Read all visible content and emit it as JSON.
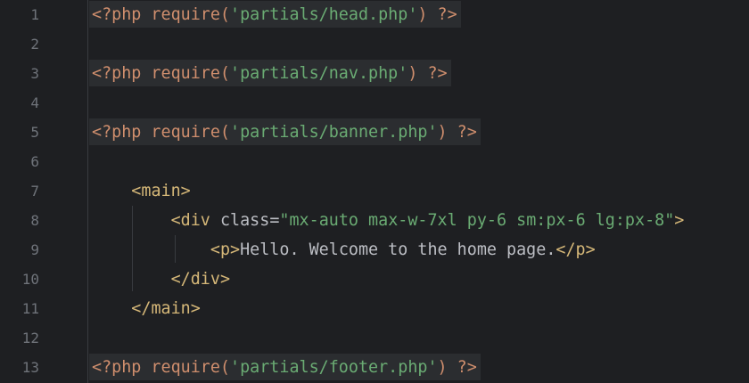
{
  "editor": {
    "lines": [
      {
        "n": "1",
        "parts": [
          [
            "php",
            "<?php require("
          ],
          [
            "str",
            "'partials/head.php'"
          ],
          [
            "php",
            ") ?>"
          ]
        ]
      },
      {
        "n": "2",
        "parts": []
      },
      {
        "n": "3",
        "parts": [
          [
            "php",
            "<?php require("
          ],
          [
            "str",
            "'partials/nav.php'"
          ],
          [
            "php",
            ") ?>"
          ]
        ]
      },
      {
        "n": "4",
        "parts": []
      },
      {
        "n": "5",
        "parts": [
          [
            "php",
            "<?php require("
          ],
          [
            "str",
            "'partials/banner.php'"
          ],
          [
            "php",
            ") ?>"
          ]
        ]
      },
      {
        "n": "6",
        "parts": []
      },
      {
        "n": "7",
        "parts": [
          [
            "txt",
            "    "
          ],
          [
            "tag",
            "<main>"
          ]
        ]
      },
      {
        "n": "8",
        "parts": [
          [
            "txt",
            "        "
          ],
          [
            "tag",
            "<div "
          ],
          [
            "attr",
            "class"
          ],
          [
            "txt",
            "="
          ],
          [
            "str",
            "\"mx-auto max-w-7xl py-6 sm:px-6 lg:px-8\""
          ],
          [
            "tag",
            ">"
          ]
        ]
      },
      {
        "n": "9",
        "parts": [
          [
            "txt",
            "            "
          ],
          [
            "tag",
            "<p>"
          ],
          [
            "txt",
            "Hello. Welcome to the home page."
          ],
          [
            "tag",
            "</p>"
          ]
        ]
      },
      {
        "n": "10",
        "parts": [
          [
            "txt",
            "        "
          ],
          [
            "tag",
            "</div>"
          ]
        ]
      },
      {
        "n": "11",
        "parts": [
          [
            "txt",
            "    "
          ],
          [
            "tag",
            "</main>"
          ]
        ]
      },
      {
        "n": "12",
        "parts": []
      },
      {
        "n": "13",
        "parts": [
          [
            "php",
            "<?php require("
          ],
          [
            "str",
            "'partials/footer.php'"
          ],
          [
            "php",
            ") ?>"
          ]
        ]
      }
    ]
  }
}
